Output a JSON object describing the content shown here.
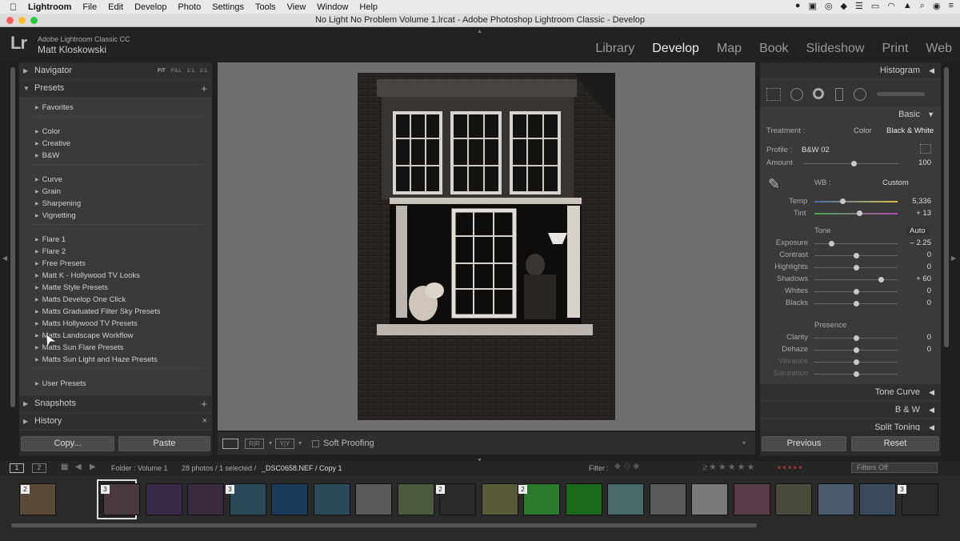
{
  "menubar": {
    "app": "Lightroom",
    "items": [
      "File",
      "Edit",
      "Develop",
      "Photo",
      "Settings",
      "Tools",
      "View",
      "Window",
      "Help"
    ]
  },
  "window_title": "No Light No Problem Volume 1.lrcat - Adobe Photoshop Lightroom Classic - Develop",
  "identity": {
    "logo": "Lr",
    "app_name": "Adobe Lightroom Classic CC",
    "user": "Matt Kloskowski"
  },
  "modules": [
    "Library",
    "Develop",
    "Map",
    "Book",
    "Slideshow",
    "Print",
    "Web"
  ],
  "left_panel": {
    "navigator": {
      "label": "Navigator",
      "zoom": [
        "FIT",
        "FILL",
        "1:1",
        "2:1"
      ]
    },
    "presets_label": "Presets",
    "preset_groups": [
      [
        "Favorites"
      ],
      [
        "Color",
        "Creative",
        "B&W"
      ],
      [
        "Curve",
        "Grain",
        "Sharpening",
        "Vignetting"
      ],
      [
        "Flare 1",
        "Flare 2",
        "Free Presets",
        "Matt K - Hollywood TV Looks",
        "Matte Style Presets",
        "Matts Develop One Click",
        "Matts Graduated Filter Sky Presets",
        "Matts Hollywood TV Presets",
        "Matts Landscape Workflow",
        "Matts Sun Flare Presets",
        "Matts Sun Light and Haze Presets"
      ],
      [
        "User Presets"
      ]
    ],
    "snapshots_label": "Snapshots",
    "history_label": "History",
    "copy_label": "Copy...",
    "paste_label": "Paste"
  },
  "toolbar": {
    "soft_proofing": "Soft Proofing"
  },
  "right_panel": {
    "histogram_label": "Histogram",
    "basic_label": "Basic",
    "treatment_label": "Treatment :",
    "treatment_color": "Color",
    "treatment_bw": "Black & White",
    "profile_label": "Profile :",
    "profile_value": "B&W 02",
    "amount_label": "Amount",
    "amount_value": "100",
    "wb_label": "WB :",
    "wb_value": "Custom",
    "temp_label": "Temp",
    "temp_value": "5,336",
    "tint_label": "Tint",
    "tint_value": "+ 13",
    "tone_label": "Tone",
    "auto_label": "Auto",
    "sliders": [
      {
        "label": "Exposure",
        "value": "– 2.25",
        "pos": 0.2
      },
      {
        "label": "Contrast",
        "value": "0",
        "pos": 0.5
      },
      {
        "label": "Highlights",
        "value": "0",
        "pos": 0.5
      },
      {
        "label": "Shadows",
        "value": "+ 60",
        "pos": 0.8
      },
      {
        "label": "Whites",
        "value": "0",
        "pos": 0.5
      },
      {
        "label": "Blacks",
        "value": "0",
        "pos": 0.5
      }
    ],
    "presence_label": "Presence",
    "presence_sliders": [
      {
        "label": "Clarity",
        "value": "0",
        "pos": 0.5
      },
      {
        "label": "Dehaze",
        "value": "0",
        "pos": 0.5
      },
      {
        "label": "Vibrance",
        "value": "",
        "pos": 0.5
      },
      {
        "label": "Saturation",
        "value": "",
        "pos": 0.5
      }
    ],
    "tone_curve_label": "Tone Curve",
    "bw_label": "B & W",
    "split_toning_label": "Split Toning",
    "previous_label": "Previous",
    "reset_label": "Reset"
  },
  "filmstrip": {
    "folder": "Folder : Volume 1",
    "count": "28 photos / 1 selected /",
    "file": "_DSC0658.NEF / Copy 1",
    "filter_label": "Filter :",
    "filters_off": "Filters Off",
    "page1": "1",
    "page2": "2"
  }
}
